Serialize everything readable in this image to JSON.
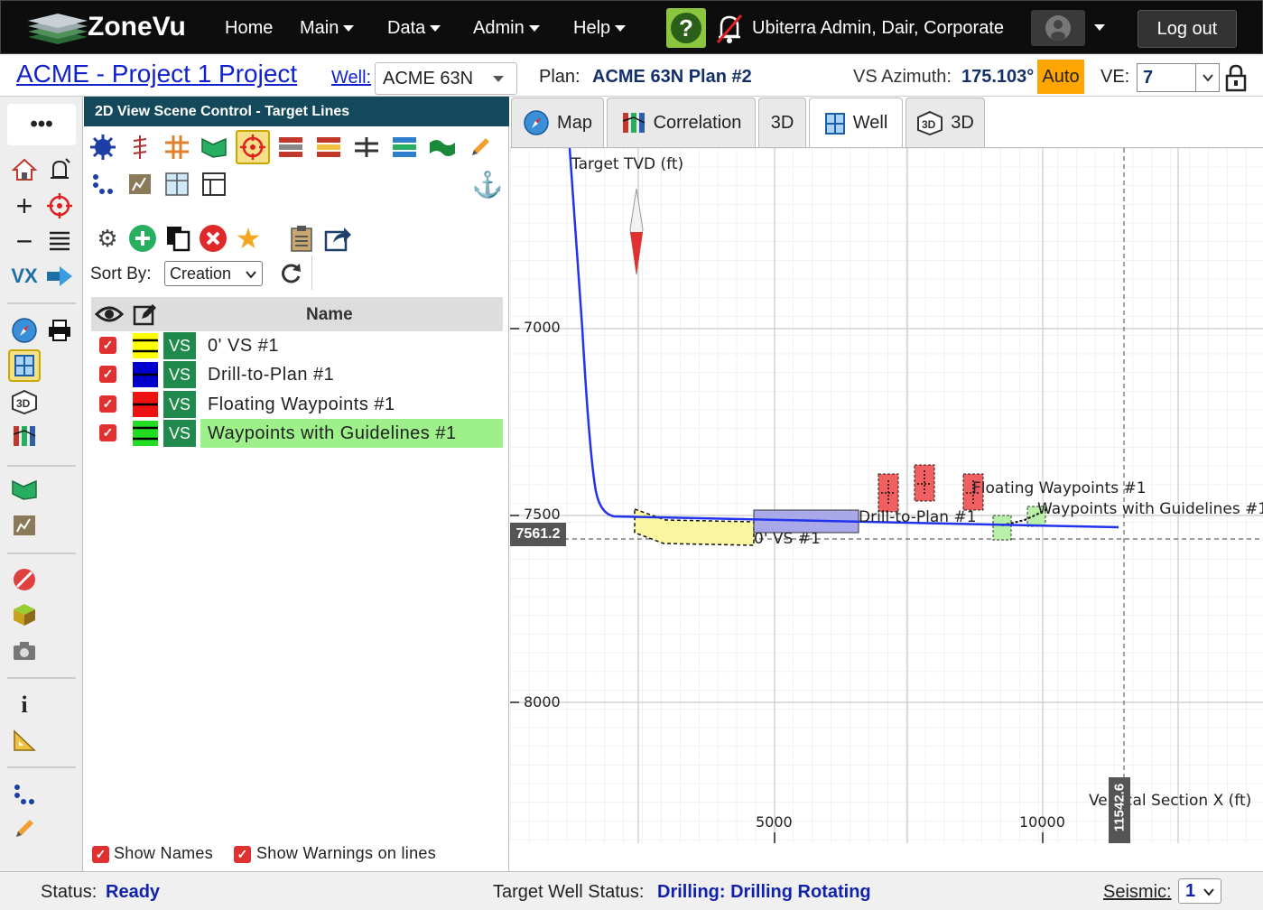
{
  "app": {
    "name": "ZoneVu"
  },
  "topnav": {
    "home": "Home",
    "main": "Main",
    "data": "Data",
    "admin": "Admin",
    "help": "Help",
    "user": "Ubiterra Admin, Dair, Corporate",
    "logout": "Log out"
  },
  "projbar": {
    "project": "ACME - Project 1 Project",
    "well_label": "Well:",
    "well_value": "ACME 63N",
    "plan_label": "Plan:",
    "plan_value": "ACME 63N Plan #2",
    "vs_label": "VS Azimuth:",
    "vs_value": "175.103°",
    "auto": "Auto",
    "ve_label": "VE:",
    "ve_value": "7"
  },
  "scene": {
    "title": "2D View Scene Control - Target Lines",
    "sort_label": "Sort By:",
    "sort_value": "Creation",
    "name_header": "Name",
    "rows": [
      {
        "vs": "VS",
        "name": "0' VS #1",
        "color": "#ffff00"
      },
      {
        "vs": "VS",
        "name": "Drill-to-Plan #1",
        "color": "#0000cc"
      },
      {
        "vs": "VS",
        "name": "Floating Waypoints #1",
        "color": "#ee1111"
      },
      {
        "vs": "VS",
        "name": "Waypoints with Guidelines #1",
        "color": "#22dd22"
      }
    ],
    "show_names": "Show Names",
    "show_warnings": "Show Warnings on lines"
  },
  "tabs": {
    "map": "Map",
    "correlation": "Correlation",
    "3d": "3D",
    "well": "Well",
    "3d2": "3D"
  },
  "plot": {
    "y_axis_title": "Target TVD (ft)",
    "x_axis_title": "Vertical Section X (ft)",
    "y_ticks": [
      "7000",
      "7500",
      "8000"
    ],
    "x_ticks": [
      "5000",
      "10000"
    ],
    "cursor_y": "7561.2",
    "cursor_x": "11542.6",
    "labels": {
      "floating": "Floating Waypoints #1",
      "waypoints": "Waypoints with Guidelines #1",
      "drill": "Drill-to-Plan #1",
      "zero_vs": "0' VS #1"
    }
  },
  "status": {
    "status_label": "Status:",
    "status_value": "Ready",
    "target_label": "Target Well Status:",
    "target_value": "Drilling: Drilling Rotating",
    "seismic_label": "Seismic:",
    "seismic_value": "1"
  },
  "colors": {
    "accent_blue": "#1122cc",
    "header_teal": "#14485b",
    "vs_green": "#1f8a4c",
    "auto_orange": "#ffa500"
  }
}
